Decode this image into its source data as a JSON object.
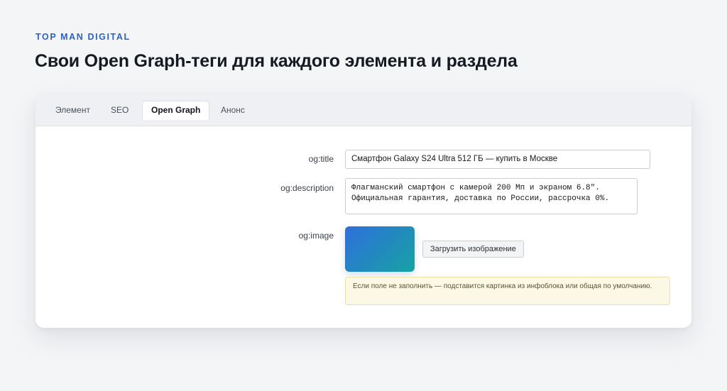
{
  "header": {
    "brand": "TOP MAN DIGITAL",
    "title": "Свои Open Graph-теги для каждого элемента и раздела"
  },
  "tabs": [
    {
      "label": "Элемент",
      "active": false
    },
    {
      "label": "SEO",
      "active": false
    },
    {
      "label": "Open Graph",
      "active": true
    },
    {
      "label": "Анонс",
      "active": false
    }
  ],
  "form": {
    "og_title": {
      "label": "og:title",
      "value": "Смартфон Galaxy S24 Ultra 512 ГБ — купить в Москве"
    },
    "og_description": {
      "label": "og:description",
      "value": "Флагманский смартфон с камерой 200 Мп и экраном 6.8″.\nОфициальная гарантия, доставка по России, рассрочка 0%."
    },
    "og_image": {
      "label": "og:image",
      "upload_label": "Загрузить изображение",
      "preview_gradient": [
        "#2f6fdc",
        "#16a3a3"
      ],
      "hint": "Если поле не заполнить — подставится картинка из инфоблока или общая по умолчанию."
    }
  },
  "colors": {
    "accent": "#2b63c6",
    "note_bg": "#fcf8e6",
    "note_border": "#ece0a8"
  }
}
